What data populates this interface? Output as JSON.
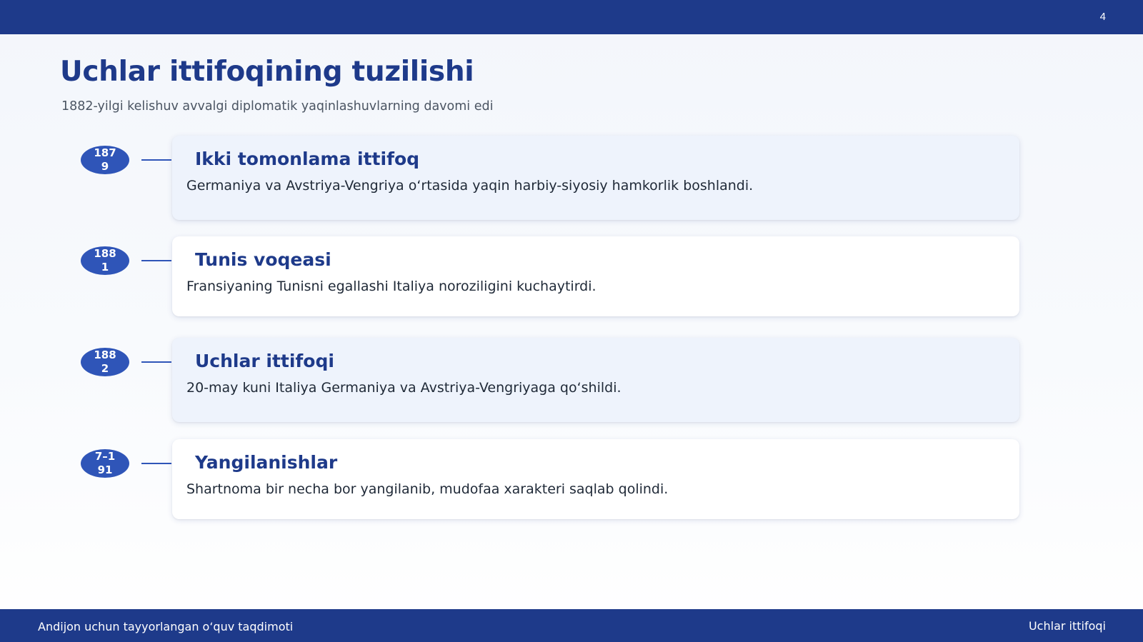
{
  "header": {
    "page_number": "4"
  },
  "slide": {
    "title": "Uchlar ittifoqining tuzilishi",
    "subtitle": "1882-yilgi kelishuv avvalgi diplomatik yaqinlashuvlarning davomi edi"
  },
  "timeline": {
    "items": [
      {
        "year": "1879",
        "title": "Ikki tomonlama ittifoq",
        "description": "Germaniya va Avstriya-Vengriya o‘rtasida yaqin harbiy-siyosiy hamkorlik boshlandi."
      },
      {
        "year": "1881",
        "title": "Tunis voqeasi",
        "description": "Fransiyaning Tunisni egallashi Italiya noroziligini kuchaytirdi."
      },
      {
        "year": "1882",
        "title": "Uchlar ittifoqi",
        "description": "20-may kuni Italiya Germaniya va Avstriya-Vengriyaga qo‘shildi."
      },
      {
        "year": "7–191",
        "title": "Yangilanishlar",
        "description": "Shartnoma bir necha bor yangilanib, mudofaa xarakteri saqlab qolindi."
      }
    ]
  },
  "footer": {
    "left_text": "Andijon uchun tayyorlangan o‘quv taqdimoti",
    "right_text": "Uchlar ittifoqi"
  },
  "colors": {
    "primary": "#1e3a8a",
    "badge": "#2f55b8",
    "card_tint": "#eef3fc"
  }
}
